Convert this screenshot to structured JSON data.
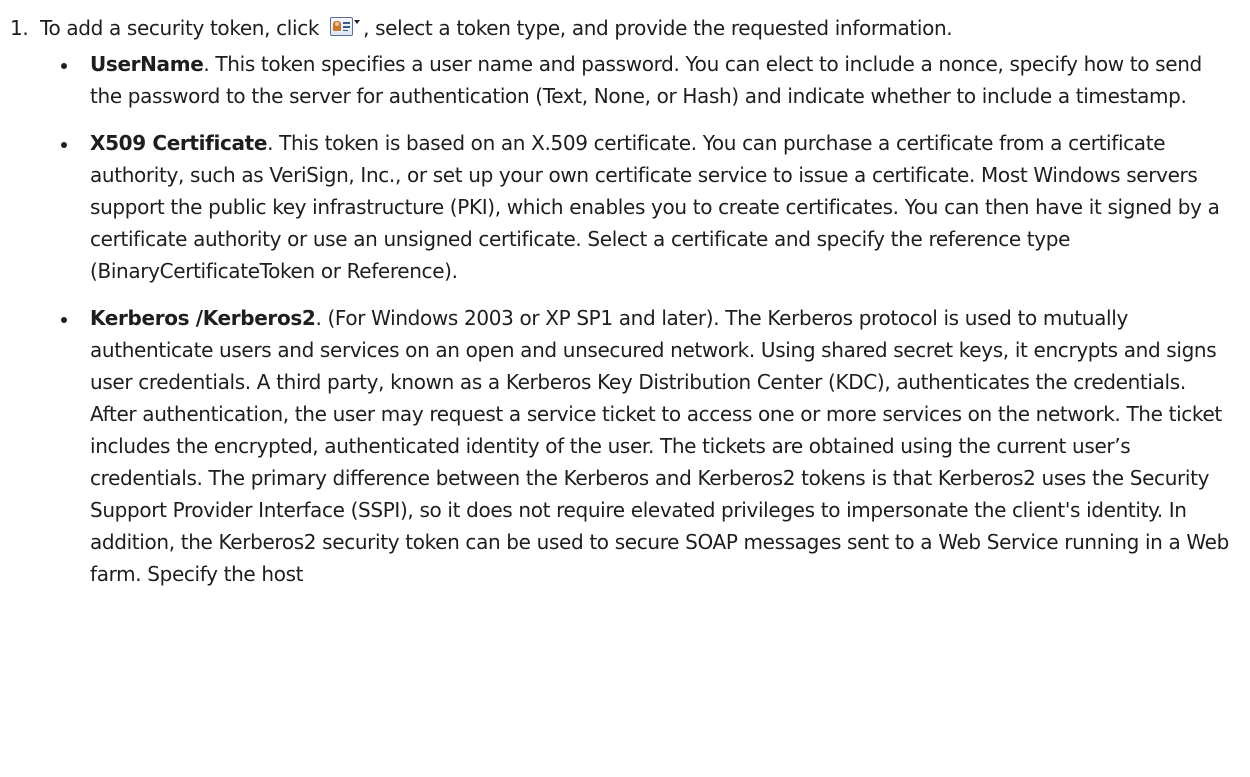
{
  "step": {
    "number": "1.",
    "text_before_icon": "To add a security token, click ",
    "text_after_icon": ", select a token type, and provide the requested information.",
    "icon": "add-security-token-icon"
  },
  "bullets": [
    {
      "term": "UserName",
      "text": ". This token specifies a user name and password. You can elect to include a nonce, specify how to send the password to the server for authentication (Text, None, or Hash) and indicate whether to include a timestamp."
    },
    {
      "term": "X509 Certificate",
      "text": ". This token is based on an X.509 certificate. You can purchase a certificate from a certificate authority, such as VeriSign, Inc., or set up your own certificate service to issue a certificate. Most Windows servers support the public key infrastructure (PKI), which enables you to create certificates. You can then have it signed by a certificate authority or use an unsigned certificate. Select a certificate and specify the reference type (BinaryCertificateToken or Reference)."
    },
    {
      "term": "Kerberos /Kerberos2",
      "text": ". (For Windows 2003 or XP SP1 and later). The Kerberos protocol is used to mutually authenticate users and services on an open and unsecured network. Using shared secret keys, it encrypts and signs user credentials. A third party, known as a Kerberos Key Distribution Center (KDC), authenticates the credentials. After authentication, the user may request a service ticket to access one or more services on the network. The ticket includes the encrypted, authenticated identity of the user. The tickets are obtained using the current user’s credentials. The primary difference between the Kerberos and Kerberos2 tokens is that Kerberos2 uses the Security Support Provider Interface (SSPI), so it does not require elevated privileges to impersonate the client's identity. In addition, the Kerberos2 security token can be used to secure SOAP messages sent to a Web Service running in a Web farm. Specify the host"
    }
  ]
}
